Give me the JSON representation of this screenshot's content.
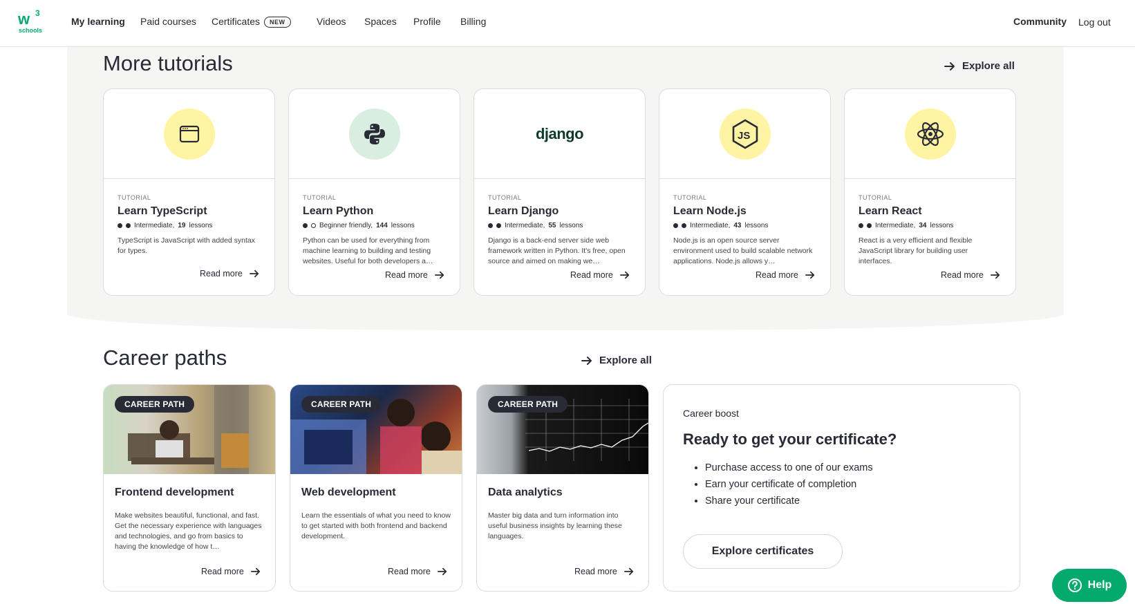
{
  "nav": {
    "logo_text": "w3 schools",
    "links": [
      "My learning",
      "Paid courses",
      "Certificates",
      "Videos",
      "Spaces",
      "Profile",
      "Billing"
    ],
    "new_badge": "NEW",
    "community": "Community",
    "logout": "Log out"
  },
  "tutorials": {
    "title": "More tutorials",
    "explore_all": "Explore all",
    "cards": [
      {
        "kicker": "TUTORIAL",
        "title": "Learn TypeScript",
        "level": "Intermediate,",
        "lessons_count": "19",
        "lessons_word": "lessons",
        "desc": "TypeScript is JavaScript with added syntax for types.",
        "read_more": "Read more",
        "icon": "browser-window-icon"
      },
      {
        "kicker": "TUTORIAL",
        "title": "Learn Python",
        "level": "Beginner friendly,",
        "lessons_count": "144",
        "lessons_word": "lessons",
        "desc": "Python can be used for everything from machine learning to building and testing websites. Useful for both developers a…",
        "read_more": "Read more",
        "icon": "python-icon"
      },
      {
        "kicker": "TUTORIAL",
        "title": "Learn Django",
        "level": "Intermediate,",
        "lessons_count": "55",
        "lessons_word": "lessons",
        "desc": "Django is a back-end server side web framework written in Python. It's free, open source and aimed on making we…",
        "read_more": "Read more",
        "icon": "django-logo",
        "logo_text": "django"
      },
      {
        "kicker": "TUTORIAL",
        "title": "Learn Node.js",
        "level": "Intermediate,",
        "lessons_count": "43",
        "lessons_word": "lessons",
        "desc": "Node.js is an open source server environment used to build scalable network applications. Node.js allows y…",
        "read_more": "Read more",
        "icon": "nodejs-icon"
      },
      {
        "kicker": "TUTORIAL",
        "title": "Learn React",
        "level": "Intermediate,",
        "lessons_count": "34",
        "lessons_word": "lessons",
        "desc": "React is a very efficient and flexible JavaScript library for building user interfaces.",
        "read_more": "Read more",
        "icon": "react-icon"
      }
    ]
  },
  "careers": {
    "title": "Career paths",
    "explore_all": "Explore all",
    "cards": [
      {
        "badge": "CAREER PATH",
        "title": "Frontend development",
        "desc": "Make websites beautiful, functional, and fast. Get the necessary experience with languages and technologies, and go from basics to having the knowledge of how t…",
        "read_more": "Read more"
      },
      {
        "badge": "CAREER PATH",
        "title": "Web development",
        "desc": "Learn the essentials of what you need to know to get started with both frontend and backend development.",
        "read_more": "Read more"
      },
      {
        "badge": "CAREER PATH",
        "title": "Data analytics",
        "desc": "Master big data and turn information into useful business insights by learning these languages.",
        "read_more": "Read more"
      }
    ]
  },
  "certificate": {
    "kicker": "Career boost",
    "heading": "Ready to get your certificate?",
    "items": [
      "Purchase access to one of our exams",
      "Earn your certificate of completion",
      "Share your certificate"
    ],
    "button": "Explore certificates"
  },
  "help": {
    "label": "Help"
  },
  "colors": {
    "brand_green": "#04aa6d",
    "yellow": "#fff4a3",
    "dark": "#282a35"
  }
}
